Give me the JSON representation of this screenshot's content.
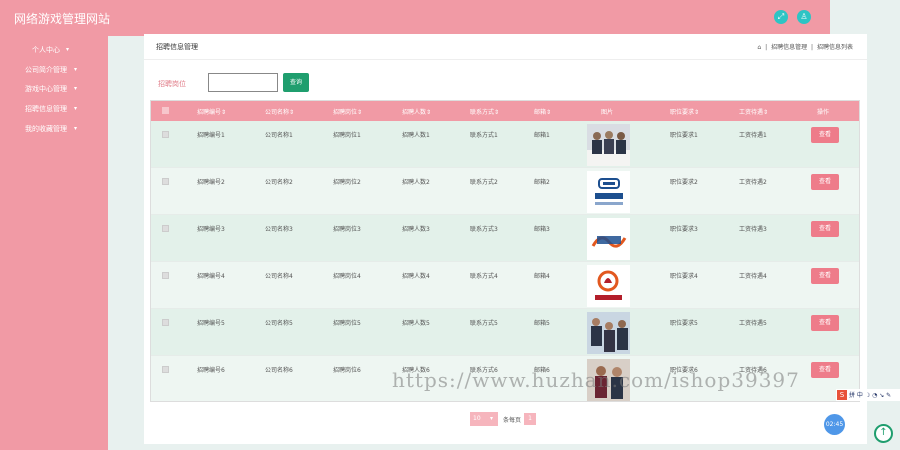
{
  "app": {
    "title": "网络游戏管理网站"
  },
  "topbar": {
    "fullscreen_icon": "fullscreen-icon",
    "user_icon": "user-icon"
  },
  "sidebar": {
    "items": [
      {
        "label": "个人中心"
      },
      {
        "label": "公司简介管理"
      },
      {
        "label": "游戏中心管理"
      },
      {
        "label": "招聘信息管理"
      },
      {
        "label": "我的收藏管理"
      }
    ]
  },
  "panel": {
    "title": "招聘信息管理",
    "breadcrumb": [
      "招聘信息管理",
      "招聘信息列表"
    ]
  },
  "search": {
    "label": "招聘岗位",
    "value": "",
    "button": "查询"
  },
  "table": {
    "headers": [
      "招聘编号",
      "公司名称",
      "招聘岗位",
      "招聘人数",
      "联系方式",
      "邮箱",
      "图片",
      "职位要求",
      "工资待遇",
      "操作"
    ],
    "rows": [
      {
        "no": "招聘编号1",
        "company": "公司名称1",
        "position": "招聘岗位1",
        "count": "招聘人数1",
        "contact": "联系方式1",
        "email": "邮箱1",
        "requirement": "职位要求1",
        "salary": "工资待遇1",
        "action": "查看"
      },
      {
        "no": "招聘编号2",
        "company": "公司名称2",
        "position": "招聘岗位2",
        "count": "招聘人数2",
        "contact": "联系方式2",
        "email": "邮箱2",
        "requirement": "职位要求2",
        "salary": "工资待遇2",
        "action": "查看"
      },
      {
        "no": "招聘编号3",
        "company": "公司名称3",
        "position": "招聘岗位3",
        "count": "招聘人数3",
        "contact": "联系方式3",
        "email": "邮箱3",
        "requirement": "职位要求3",
        "salary": "工资待遇3",
        "action": "查看"
      },
      {
        "no": "招聘编号4",
        "company": "公司名称4",
        "position": "招聘岗位4",
        "count": "招聘人数4",
        "contact": "联系方式4",
        "email": "邮箱4",
        "requirement": "职位要求4",
        "salary": "工资待遇4",
        "action": "查看"
      },
      {
        "no": "招聘编号5",
        "company": "公司名称5",
        "position": "招聘岗位5",
        "count": "招聘人数5",
        "contact": "联系方式5",
        "email": "邮箱5",
        "requirement": "职位要求5",
        "salary": "工资待遇5",
        "action": "查看"
      },
      {
        "no": "招聘编号6",
        "company": "公司名称6",
        "position": "招聘岗位6",
        "count": "招聘人数6",
        "contact": "联系方式6",
        "email": "邮箱6",
        "requirement": "职位要求6",
        "salary": "工资待遇6",
        "action": "查看"
      }
    ]
  },
  "pager": {
    "page_size": "10",
    "per_page_label": "条每页",
    "page": "1"
  },
  "watermark": "https://www.huzhan.com/ishop39397",
  "ime": {
    "label": "拼 中 ☽ ◔ ↘ ✎"
  },
  "clock": "02:45",
  "colors": {
    "accent": "#f19aa5",
    "button": "#ee7c8a",
    "search": "#1f9e6e"
  }
}
